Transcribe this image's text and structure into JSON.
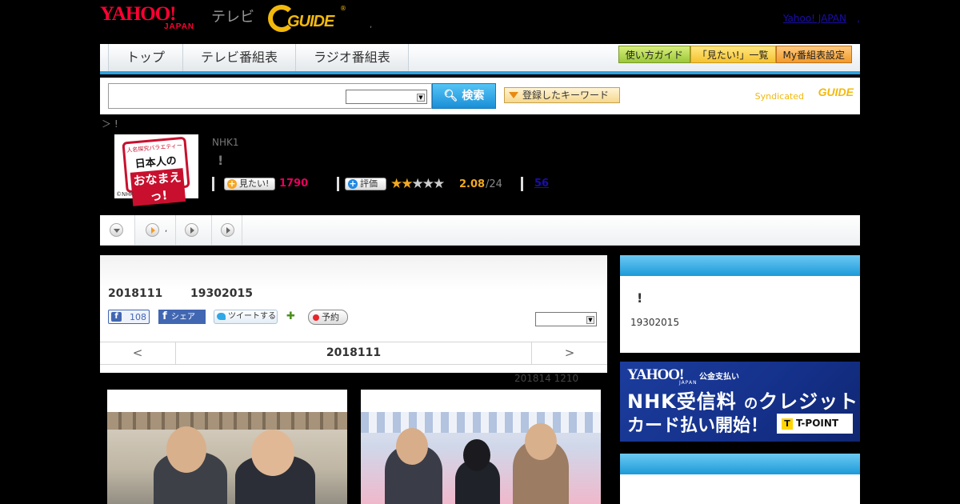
{
  "header": {
    "logo_yahoo": "YAHOO!",
    "logo_japan": "JAPAN",
    "logo_tv": "テレビ",
    "logo_gguide": "GUIDE",
    "logo_gguide_reg": "®",
    "dot": ",",
    "yahoo_japan_link": "Yahoo! JAPAN",
    "link_sep": ","
  },
  "nav": {
    "tabs": [
      "トップ",
      "テレビ番組表",
      "ラジオ番組表"
    ],
    "buttons": [
      "使い方ガイド",
      "「見たい!」一覧",
      "My番組表設定"
    ]
  },
  "search": {
    "input_value": "",
    "select_value": "",
    "button_label": "検索",
    "keyword_button": "登録したキーワード",
    "syndicated_label": "Syndicated",
    "syndicated_logo": "GUIDE"
  },
  "breadcrumb": "＞ !",
  "program": {
    "thumb": {
      "top": "人名探究バラエティー",
      "mid": "日本人の",
      "bottom": "おなまえっ!",
      "credit": "©NHK"
    },
    "channel": "NHK1",
    "title": "!",
    "watch_label": "見たい!",
    "watch_count": "1790",
    "rate_label": "評価",
    "rating_value": 2.08,
    "rating_display": "2.08",
    "rating_max": "/24",
    "review_count": "56"
  },
  "tabstrip": {
    "dot": ","
  },
  "main": {
    "air_date": "2018111",
    "air_time": "19302015",
    "fb_like_count": "108",
    "fb_share_label": "シェア",
    "tweet_label": "ツイートする",
    "reserve_label": "予約",
    "select_value": "",
    "date_nav": {
      "prev": "<",
      "date": "2018111",
      "next": ">"
    },
    "updated": "201814  1210"
  },
  "side": {
    "title": "!",
    "time": "19302015"
  },
  "ad": {
    "brand": "YAHOO!",
    "brand_japan": "JAPAN",
    "tag": "公金支払い",
    "line1_a": "NHK受信料",
    "line1_b": "の",
    "line1_c": "クレジット",
    "line2": "カード払い開始！",
    "tpoint": "T-POINT",
    "tpoint_icon": "T"
  },
  "colors": {
    "accent_blue": "#2da1e0",
    "watch_pink": "#e6005c",
    "rating_orange": "#f2a91e",
    "yahoo_red": "#ff0033"
  }
}
